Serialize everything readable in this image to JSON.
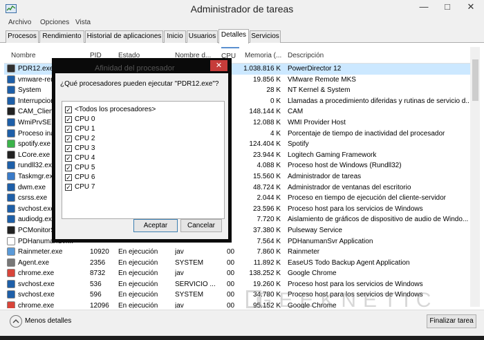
{
  "window": {
    "title": "Administrador de tareas",
    "min_glyph": "—",
    "max_glyph": "□",
    "close_glyph": "✕"
  },
  "menu": [
    "Archivo",
    "Opciones",
    "Vista"
  ],
  "tabs": [
    {
      "label": "Procesos",
      "active": false
    },
    {
      "label": "Rendimiento",
      "active": false
    },
    {
      "label": "Historial de aplicaciones",
      "active": false
    },
    {
      "label": "Inicio",
      "active": false
    },
    {
      "label": "Usuarios",
      "active": false
    },
    {
      "label": "Detalles",
      "active": true
    },
    {
      "label": "Servicios",
      "active": false
    }
  ],
  "columns": {
    "name": "Nombre",
    "pid": "PID",
    "state": "Estado",
    "user": "Nombre d...",
    "cpu": "CPU",
    "mem": "Memoria (...",
    "desc": "Descripción"
  },
  "rows": [
    {
      "name": "PDR12.exe",
      "pid": "",
      "state": "",
      "user": "",
      "cpu": "",
      "mem": "1.038.816 K",
      "desc": "PowerDirector 12",
      "selected": true,
      "icon": "#2f2f2f"
    },
    {
      "name": "vmware-remote...",
      "pid": "",
      "state": "",
      "user": "",
      "cpu": "",
      "mem": "19.856 K",
      "desc": "VMware Remote MKS",
      "icon": "#1e5fa8"
    },
    {
      "name": "System",
      "pid": "",
      "state": "",
      "user": "",
      "cpu": "",
      "mem": "28 K",
      "desc": "NT Kernel & System",
      "icon": "#1e5fa8"
    },
    {
      "name": "Interrupciones...",
      "pid": "",
      "state": "",
      "user": "",
      "cpu": "",
      "mem": "0 K",
      "desc": "Llamadas a procedimiento diferidas y rutinas de servicio d...",
      "icon": "#1e5fa8"
    },
    {
      "name": "CAM_Client.exe",
      "pid": "",
      "state": "",
      "user": "",
      "cpu": "",
      "mem": "148.144 K",
      "desc": "CAM",
      "icon": "#222"
    },
    {
      "name": "WmiPrvSE.exe",
      "pid": "",
      "state": "",
      "user": "",
      "cpu": "",
      "mem": "12.088 K",
      "desc": "WMI Provider Host",
      "icon": "#1e5fa8"
    },
    {
      "name": "Proceso inactivo...",
      "pid": "",
      "state": "",
      "user": "",
      "cpu": "",
      "mem": "4 K",
      "desc": "Porcentaje de tiempo de inactividad del procesador",
      "icon": "#1e5fa8"
    },
    {
      "name": "spotify.exe",
      "pid": "",
      "state": "",
      "user": "",
      "cpu": "",
      "mem": "124.404 K",
      "desc": "Spotify",
      "icon": "#3bb34a"
    },
    {
      "name": "LCore.exe",
      "pid": "",
      "state": "",
      "user": "",
      "cpu": "",
      "mem": "23.944 K",
      "desc": "Logitech Gaming Framework",
      "icon": "#222"
    },
    {
      "name": "rundll32.exe",
      "pid": "",
      "state": "",
      "user": "",
      "cpu": "",
      "mem": "4.088 K",
      "desc": "Proceso host de Windows (Rundll32)",
      "icon": "#1e5fa8"
    },
    {
      "name": "Taskmgr.exe",
      "pid": "",
      "state": "",
      "user": "",
      "cpu": "",
      "mem": "15.560 K",
      "desc": "Administrador de tareas",
      "icon": "#3a7bc8"
    },
    {
      "name": "dwm.exe",
      "pid": "",
      "state": "",
      "user": "",
      "cpu": "",
      "mem": "48.724 K",
      "desc": "Administrador de ventanas del escritorio",
      "icon": "#1e5fa8"
    },
    {
      "name": "csrss.exe",
      "pid": "",
      "state": "",
      "user": "",
      "cpu": "",
      "mem": "2.044 K",
      "desc": "Proceso en tiempo de ejecución del cliente-servidor",
      "icon": "#1e5fa8"
    },
    {
      "name": "svchost.exe",
      "pid": "",
      "state": "",
      "user": "",
      "cpu": "",
      "mem": "23.596 K",
      "desc": "Proceso host para los servicios de Windows",
      "icon": "#1e5fa8"
    },
    {
      "name": "audiodg.exe",
      "pid": "",
      "state": "",
      "user": "",
      "cpu": "",
      "mem": "7.720 K",
      "desc": "Aislamiento de gráficos de dispositivo de audio de Windo...",
      "icon": "#1e5fa8"
    },
    {
      "name": "PCMonitorSrv.exe",
      "pid": "",
      "state": "",
      "user": "",
      "cpu": "",
      "mem": "37.380 K",
      "desc": "Pulseway Service",
      "icon": "#222"
    },
    {
      "name": "PDHanumanSvr...",
      "pid": "",
      "state": "",
      "user": "",
      "cpu": "",
      "mem": "7.564 K",
      "desc": "PDHanumanSvr Application",
      "icon": "#ffffff"
    },
    {
      "name": "Rainmeter.exe",
      "pid": "10920",
      "state": "En ejecución",
      "user": "jav",
      "cpu": "00",
      "mem": "7.860 K",
      "desc": "Rainmeter",
      "icon": "#5a9ad8"
    },
    {
      "name": "Agent.exe",
      "pid": "2356",
      "state": "En ejecución",
      "user": "SYSTEM",
      "cpu": "00",
      "mem": "11.892 K",
      "desc": "EaseUS Todo Backup Agent Application",
      "icon": "#777"
    },
    {
      "name": "chrome.exe",
      "pid": "8732",
      "state": "En ejecución",
      "user": "jav",
      "cpu": "00",
      "mem": "138.252 K",
      "desc": "Google Chrome",
      "icon": "#d8453a"
    },
    {
      "name": "svchost.exe",
      "pid": "536",
      "state": "En ejecución",
      "user": "SERVICIO ...",
      "cpu": "00",
      "mem": "19.260 K",
      "desc": "Proceso host para los servicios de Windows",
      "icon": "#1e5fa8"
    },
    {
      "name": "svchost.exe",
      "pid": "596",
      "state": "En ejecución",
      "user": "SYSTEM",
      "cpu": "00",
      "mem": "34.780 K",
      "desc": "Proceso host para los servicios de Windows",
      "icon": "#1e5fa8"
    },
    {
      "name": "chrome.exe",
      "pid": "12096",
      "state": "En ejecución",
      "user": "jav",
      "cpu": "00",
      "mem": "95.152 K",
      "desc": "Google Chrome",
      "icon": "#d8453a"
    }
  ],
  "footer": {
    "less_details_label": "Menos detalles",
    "end_task_label": "Finalizar tarea"
  },
  "dialog": {
    "title": "Afinidad del procesador",
    "close_glyph": "✕",
    "question": "¿Qué procesadores pueden ejecutar \"PDR12.exe\"?",
    "items": [
      {
        "label": "<Todos los procesadores>",
        "checked": true
      },
      {
        "label": "CPU 0",
        "checked": true
      },
      {
        "label": "CPU 1",
        "checked": true
      },
      {
        "label": "CPU 2",
        "checked": true
      },
      {
        "label": "CPU 3",
        "checked": true
      },
      {
        "label": "CPU 4",
        "checked": true
      },
      {
        "label": "CPU 5",
        "checked": true
      },
      {
        "label": "CPU 6",
        "checked": true
      },
      {
        "label": "CPU 7",
        "checked": true
      }
    ],
    "accept_label": "Aceptar",
    "cancel_label": "Cancelar",
    "check_glyph": "✓"
  },
  "watermark": "GEEKNETIC",
  "colors": {
    "selection": "#cce8ff",
    "accent": "#5a8fd0",
    "close_red": "#c63c3a"
  }
}
